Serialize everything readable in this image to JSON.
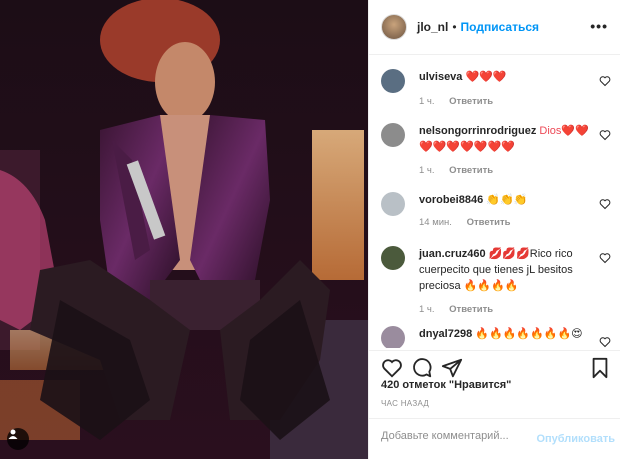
{
  "post": {
    "username": "jlo_nl",
    "dot": "•",
    "follow_label": "Подписаться",
    "more_label": "•••",
    "image_alt": "Фото публикации"
  },
  "comments": [
    {
      "user": "ulviseva",
      "text": "❤️❤️❤️",
      "time": "1 ч.",
      "reply": "Ответить",
      "avatar_color": "#5a6e82"
    },
    {
      "user": "nelsongorrinrodriguez",
      "text": "Dios❤️❤️❤️❤️❤️❤️❤️❤️❤️",
      "time": "1 ч.",
      "reply": "Ответить",
      "avatar_color": "#8c8c8c"
    },
    {
      "user": "vorobei8846",
      "text": "👏👏👏",
      "time": "14 мин.",
      "reply": "Ответить",
      "avatar_color": "#b9c0c6"
    },
    {
      "user": "juan.cruz460",
      "text": "💋💋💋Rico rico cuerpecito que tienes jL besitos preciosa 🔥🔥🔥🔥",
      "time": "1 ч.",
      "reply": "Ответить",
      "avatar_color": "#4b5a3c"
    },
    {
      "user": "dnyal7298",
      "text": "🔥🔥🔥🔥🔥🔥🔥😍",
      "time": "",
      "reply": "",
      "avatar_color": "#9a8c9e"
    }
  ],
  "likes_text": "420 отметок \"Нравится\"",
  "time_ago": "час назад",
  "add_comment": {
    "placeholder": "Добавьте комментарий...",
    "publish_label": "Опубликовать"
  },
  "colors": {
    "accent": "#0095f6",
    "publish_disabled": "#b2dffc",
    "heart": "#ed4956"
  },
  "icons": [
    "heart-icon",
    "comment-icon",
    "share-icon",
    "bookmark-icon",
    "tag-people-icon",
    "more-icon"
  ]
}
